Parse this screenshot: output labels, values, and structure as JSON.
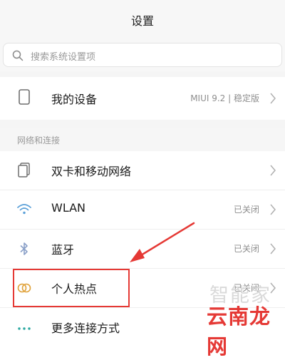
{
  "header": {
    "title": "设置"
  },
  "search": {
    "placeholder": "搜索系统设置项"
  },
  "my_device": {
    "label": "我的设备",
    "value": "MIUI 9.2 | 稳定版"
  },
  "section": {
    "label": "网络和连接"
  },
  "rows": [
    {
      "label": "双卡和移动网络",
      "value": ""
    },
    {
      "label": "WLAN",
      "value": "已关闭"
    },
    {
      "label": "蓝牙",
      "value": "已关闭"
    },
    {
      "label": "个人热点",
      "value": "已关闭"
    },
    {
      "label": "更多连接方式",
      "value": ""
    }
  ],
  "watermark": {
    "line1": "智能家",
    "line2": "云南龙网"
  },
  "colors": {
    "highlight": "#e53935",
    "icon": "#7a7a7a",
    "bluetooth": "#8aa0c8",
    "hotspot": "#e0a23a",
    "more": "#2aa8a0"
  }
}
